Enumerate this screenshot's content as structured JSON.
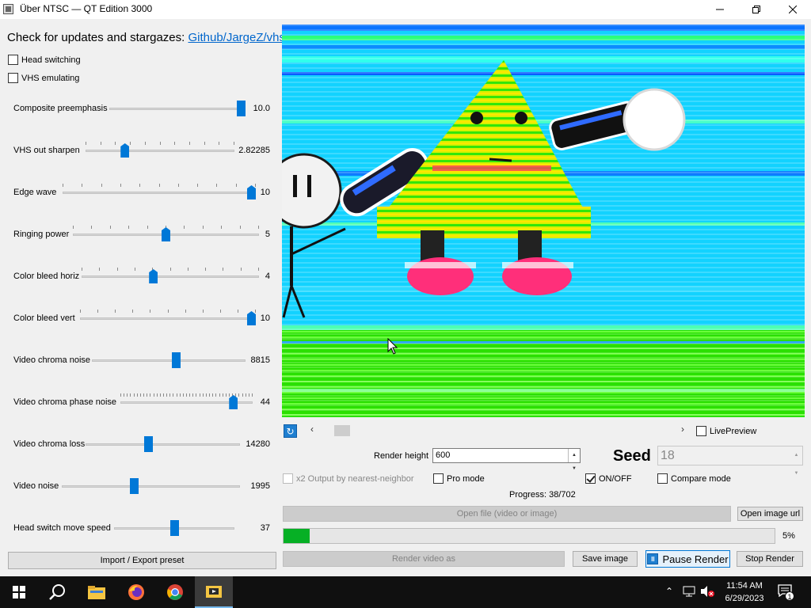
{
  "window": {
    "title": "Über NTSC — QT Edition 3000"
  },
  "left_panel": {
    "updates_text": "Check for updates and stargazes:",
    "updates_link": "Github/JargeZ/vhs",
    "checkboxes": [
      {
        "label": "Head switching",
        "checked": false
      },
      {
        "label": "VHS emulating",
        "checked": false
      }
    ],
    "sliders": [
      {
        "label": "Composite preemphasis",
        "value": "10.0",
        "fraction": 1.0,
        "ticks": false
      },
      {
        "label": "VHS out sharpen",
        "value": "2.82285",
        "fraction": 0.25,
        "ticks": true
      },
      {
        "label": "Edge wave",
        "value": "10",
        "fraction": 1.0,
        "ticks": true
      },
      {
        "label": "Ringing power",
        "value": "5",
        "fraction": 0.5,
        "ticks": true
      },
      {
        "label": "Color bleed horiz",
        "value": "4",
        "fraction": 0.4,
        "ticks": true
      },
      {
        "label": "Color bleed vert",
        "value": "10",
        "fraction": 1.0,
        "ticks": true
      },
      {
        "label": "Video chroma noise",
        "value": "8815",
        "fraction": 0.55,
        "ticks": false
      },
      {
        "label": "Video chroma phase noise",
        "value": "44",
        "fraction": 0.88,
        "ticks": true
      },
      {
        "label": "Video chroma loss",
        "value": "14280",
        "fraction": 0.4,
        "ticks": false
      },
      {
        "label": "Video noise",
        "value": "1995",
        "fraction": 0.4,
        "ticks": false
      },
      {
        "label": "Head switch move speed",
        "value": "37",
        "fraction": 0.5,
        "ticks": false
      }
    ],
    "preset_button": "Import / Export preset"
  },
  "preview": {
    "live_preview_label": "LivePreview",
    "live_preview_checked": false
  },
  "controls": {
    "render_height_label": "Render height",
    "render_height_value": "600",
    "seed_label": "Seed",
    "seed_value": "18",
    "x2_output_label": "x2 Output by nearest-neighbor",
    "pro_mode_label": "Pro mode",
    "onoff_label": "ON/OFF",
    "onoff_checked": true,
    "compare_mode_label": "Compare mode",
    "progress_text": "Progress: 38/702",
    "progress_fraction": 0.054,
    "progress_percent": "5%",
    "open_file_button": "Open file (video or image)",
    "open_url_button": "Open image url",
    "render_video_button": "Render video as",
    "save_image_button": "Save image",
    "pause_button": "Pause Render",
    "stop_button": "Stop Render"
  },
  "taskbar": {
    "time": "11:54 AM",
    "date": "6/29/2023",
    "notification_count": "1"
  },
  "colors": {
    "accent": "#0078d7",
    "progress": "#06b025"
  }
}
